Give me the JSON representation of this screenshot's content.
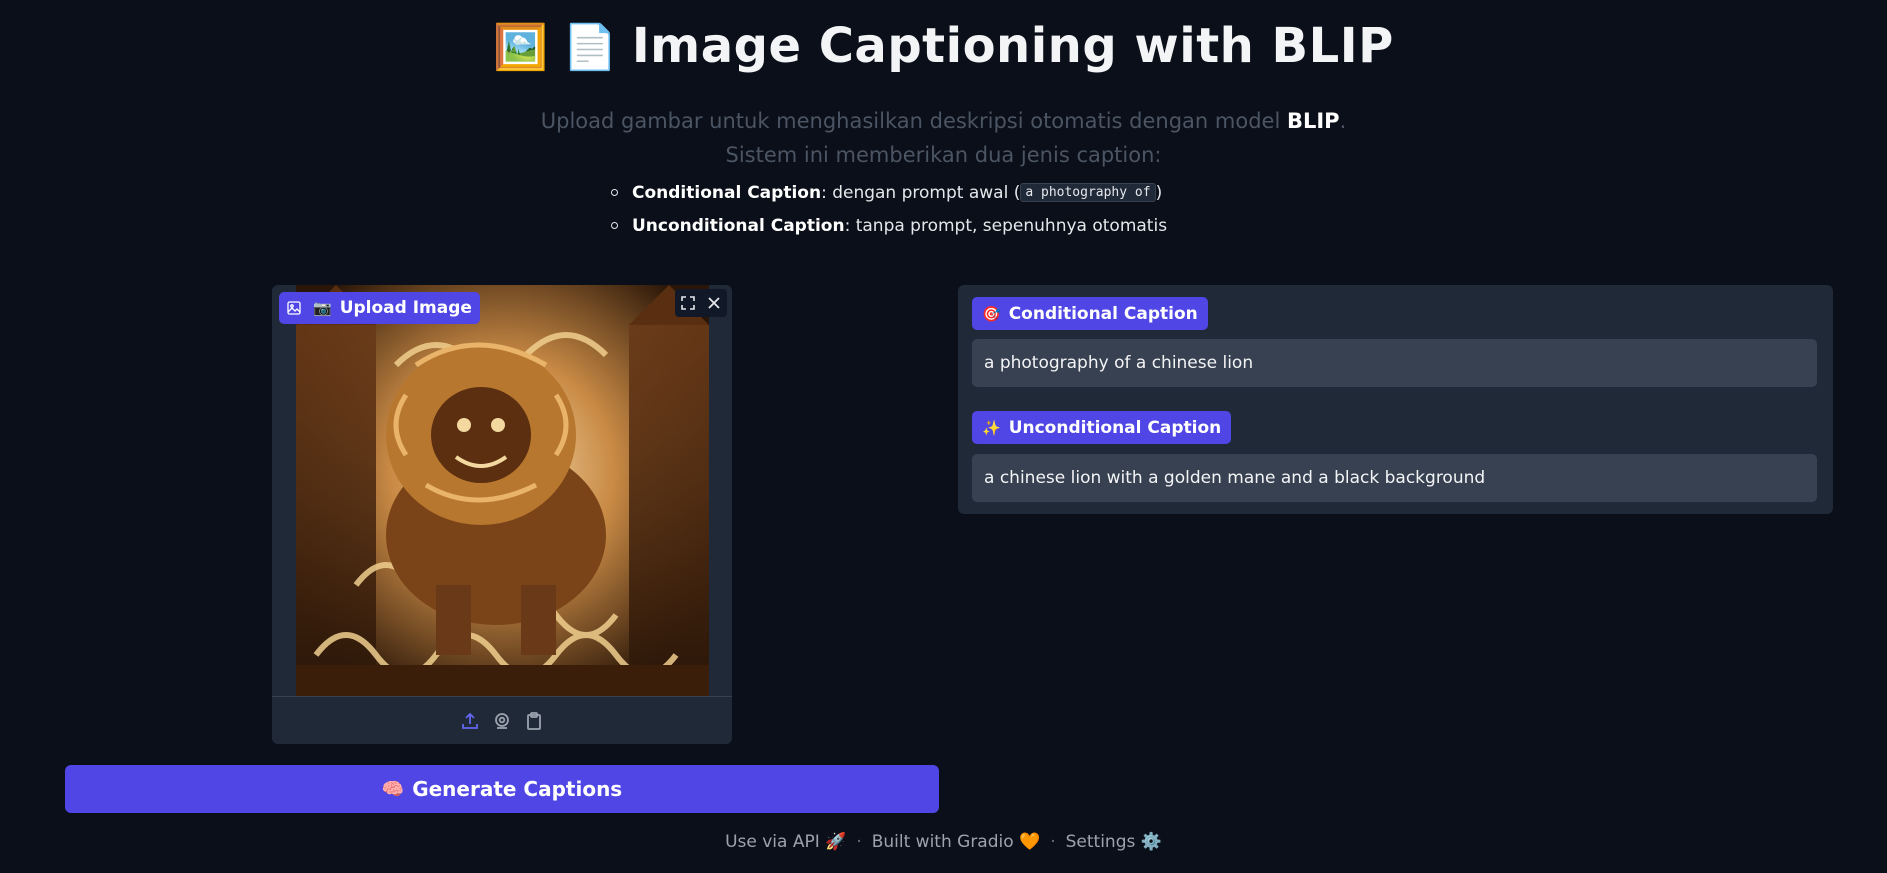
{
  "header": {
    "emoji1": "🖼️",
    "emoji2": "📄",
    "title": "Image Captioning with BLIP",
    "subtitle_line1_prefix": "Upload gambar untuk menghasilkan deskripsi otomatis dengan model ",
    "subtitle_line1_bold": "BLIP",
    "subtitle_line1_suffix": ".",
    "subtitle_line2": "Sistem ini memberikan dua jenis caption:"
  },
  "bullets": [
    {
      "bold": "Conditional Caption",
      "text": ": dengan prompt awal (",
      "code": "a photography of",
      "tail": ")"
    },
    {
      "bold": "Unconditional Caption",
      "text": ": tanpa prompt, sepenuhnya otomatis"
    }
  ],
  "image_panel": {
    "label_emoji": "📷",
    "label": "Upload Image",
    "footer_icons": [
      "upload-icon",
      "webcam-icon",
      "clipboard-icon"
    ],
    "controls": [
      "fullscreen-icon",
      "close-icon"
    ]
  },
  "captions": {
    "conditional": {
      "emoji": "🎯",
      "label": "Conditional Caption",
      "value": "a photography of a chinese lion"
    },
    "unconditional": {
      "emoji": "✨",
      "label": "Unconditional Caption",
      "value": "a chinese lion with a golden mane and a black background"
    }
  },
  "generate_button": {
    "emoji": "🧠",
    "label": "Generate Captions"
  },
  "footer": {
    "api": "Use via API",
    "api_emoji": "🚀",
    "built": "Built with Gradio",
    "built_emoji": "🧡",
    "settings": "Settings",
    "settings_emoji": "⚙️",
    "separator": "·"
  },
  "colors": {
    "background": "#0b0f19",
    "accent": "#4f46e5",
    "panel": "#1f2937",
    "field": "#374151"
  }
}
